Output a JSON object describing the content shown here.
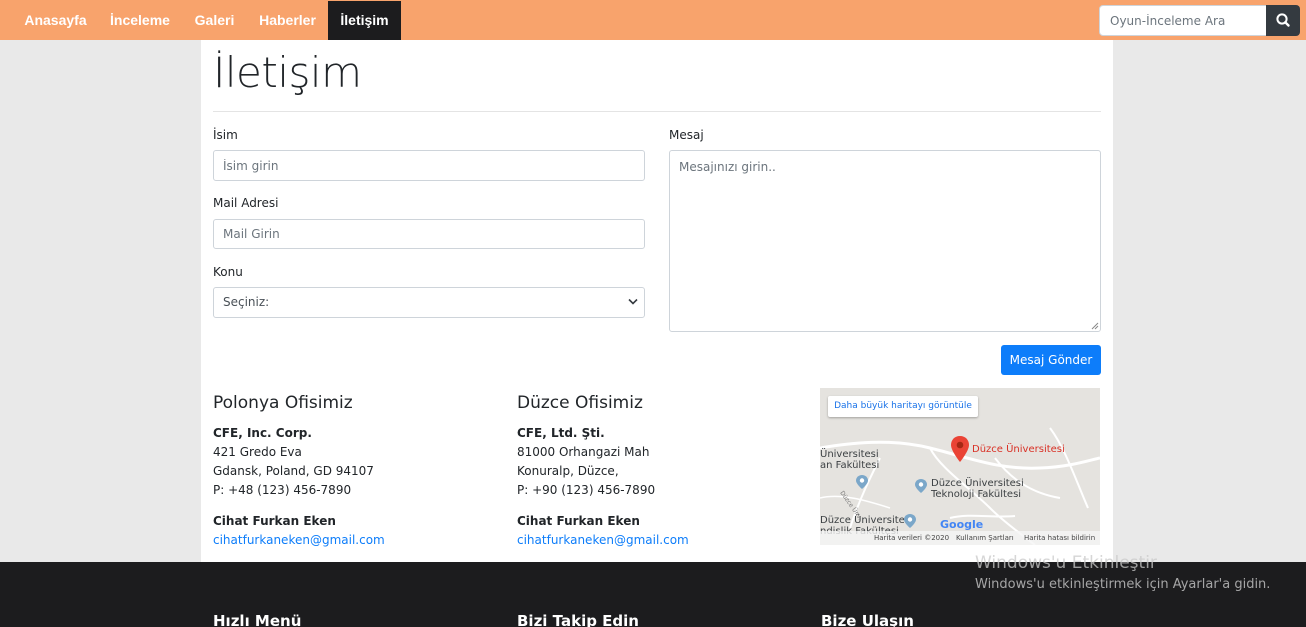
{
  "nav": {
    "items": [
      {
        "label": "Anasayfa"
      },
      {
        "label": "İnceleme"
      },
      {
        "label": "Galeri"
      },
      {
        "label": "Haberler"
      },
      {
        "label": "İletişim",
        "active": true
      }
    ],
    "search_placeholder": "Oyun-İnceleme Ara",
    "search_icon": "search-icon",
    "bg_color": "#f8a36c",
    "active_color": "#1c1c1e"
  },
  "page": {
    "title": "İletişim"
  },
  "form": {
    "name_label": "İsim",
    "name_placeholder": "İsim girin",
    "mail_label": "Mail Adresi",
    "mail_placeholder": "Mail Girin",
    "subject_label": "Konu",
    "subject_selected": "Seçiniz:",
    "message_label": "Mesaj",
    "message_placeholder": "Mesajınızı girin..",
    "submit_label": "Mesaj Gönder",
    "submit_color": "#0d7dfa"
  },
  "offices": [
    {
      "title": "Polonya Ofisimiz",
      "company": "CFE, Inc. Corp.",
      "address1": "421 Gredo Eva",
      "address2": "Gdansk, Poland, GD 94107",
      "phone": "P: +48 (123) 456-7890",
      "contact_name": "Cihat Furkan Eken",
      "email": "cihatfurkaneken@gmail.com"
    },
    {
      "title": "Düzce Ofisimiz",
      "company": "CFE, Ltd. Şti.",
      "address1": "81000 Orhangazi Mah",
      "address2": "Konuralp, Düzce,",
      "phone": "P: +90 (123) 456-7890",
      "contact_name": "Cihat Furkan Eken",
      "email": "cihatfurkaneken@gmail.com"
    }
  ],
  "map": {
    "larger_map_label": "Daha büyük haritayı görüntüle",
    "place_label": "Düzce Üniversitesi",
    "label_left_1": "Üniversitesi",
    "label_left_2": "an Fakültesi",
    "label_tech_1": "Düzce Üniversitesi",
    "label_tech_2": "Teknoloji Fakültesi",
    "label_bottom_1": "Düzce Üniversitesi",
    "label_bottom_2": "ndislik Fakültesi",
    "road_label": "Düzce Ünv.",
    "google_logo": "Google",
    "footer_data": "Harita verileri ©2020",
    "footer_terms": "Kullanım Şartları",
    "footer_report": "Harita hatası bildirin"
  },
  "footer": {
    "headings": [
      "Hızlı Menü",
      "Bizi Takip Edin",
      "Bize Ulaşın"
    ]
  },
  "watermark": {
    "line1": "Windows'u Etkinleştir",
    "line2": "Windows'u etkinleştirmek için Ayarlar'a gidin."
  }
}
